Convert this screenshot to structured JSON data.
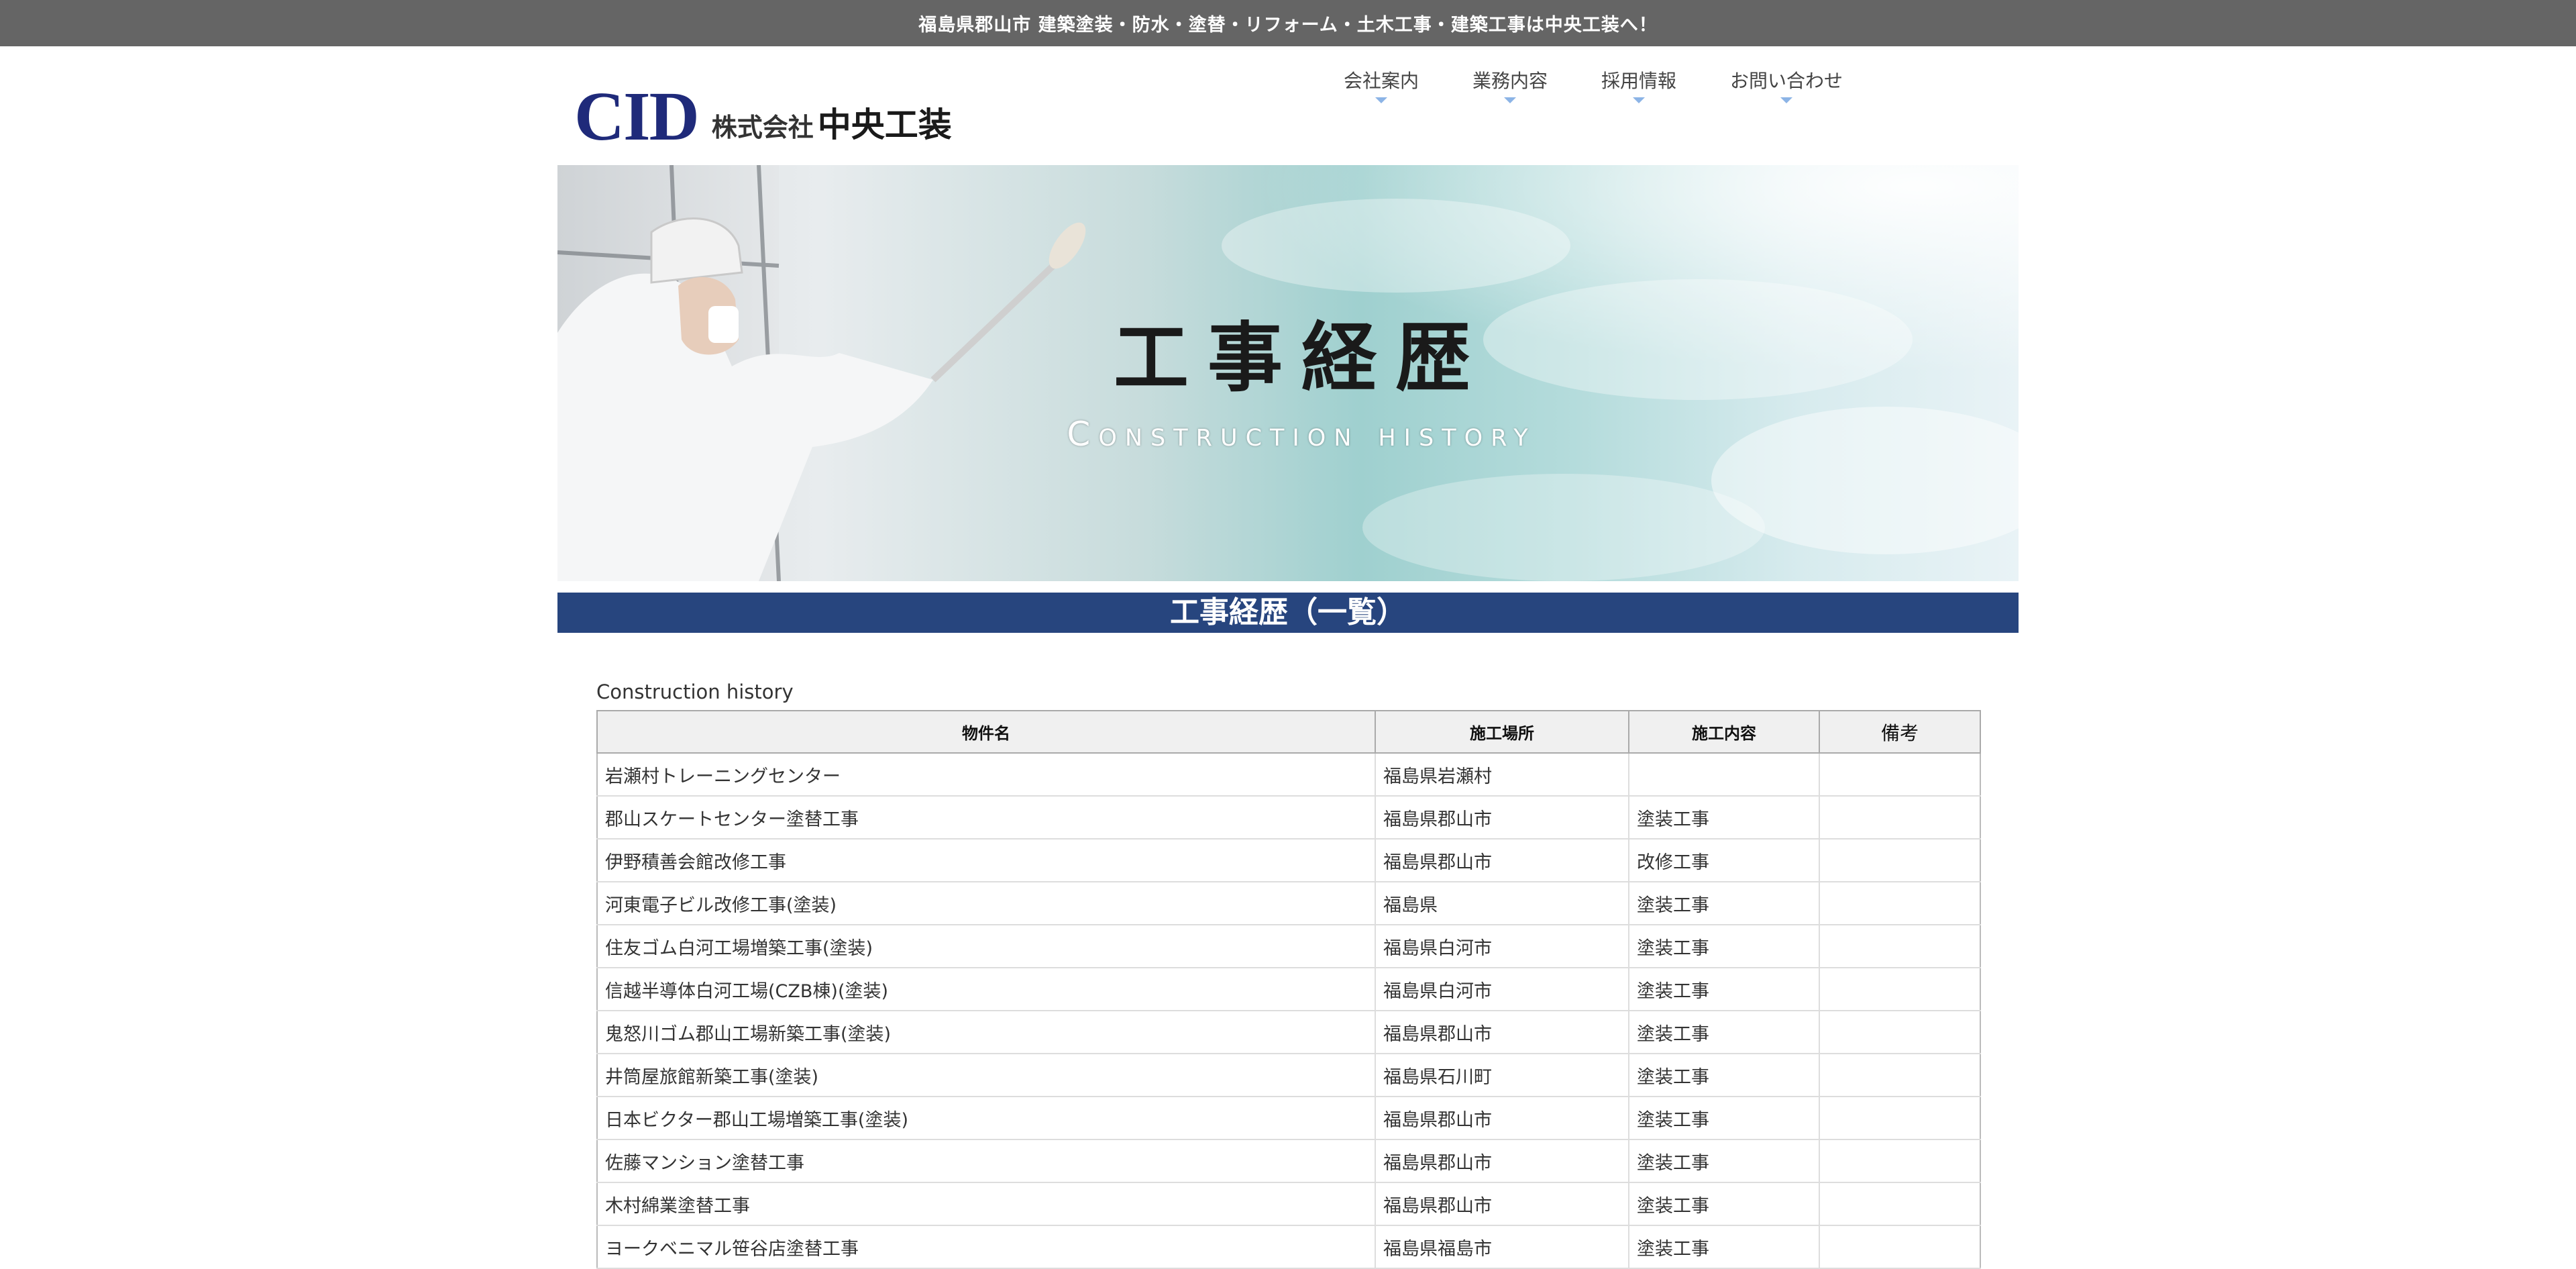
{
  "topbar": {
    "text": "福島県郡山市 建築塗装・防水・塗替・リフォーム・土木工事・建築工事は中央工装へ！"
  },
  "logo": {
    "mark": "CID",
    "kabu": "株式会社",
    "name": "中央工装"
  },
  "nav": {
    "items": [
      {
        "label": "会社案内"
      },
      {
        "label": "業務内容"
      },
      {
        "label": "採用情報"
      },
      {
        "label": "お問い合わせ"
      }
    ]
  },
  "hero": {
    "title_jp": "工事経歴",
    "title_en": "Construction history"
  },
  "banner": {
    "title": "工事経歴（一覧）"
  },
  "table": {
    "caption": "Construction history",
    "headers": [
      "物件名",
      "施工場所",
      "施工内容",
      "備考"
    ],
    "rows": [
      [
        "岩瀬村トレーニングセンター",
        "福島県岩瀬村",
        "",
        ""
      ],
      [
        "郡山スケートセンター塗替工事",
        "福島県郡山市",
        "塗装工事",
        ""
      ],
      [
        "伊野積善会館改修工事",
        "福島県郡山市",
        "改修工事",
        ""
      ],
      [
        "河東電子ビル改修工事(塗装)",
        "福島県",
        "塗装工事",
        ""
      ],
      [
        "住友ゴム白河工場増築工事(塗装)",
        "福島県白河市",
        "塗装工事",
        ""
      ],
      [
        "信越半導体白河工場(CZB棟)(塗装)",
        "福島県白河市",
        "塗装工事",
        ""
      ],
      [
        "鬼怒川ゴム郡山工場新築工事(塗装)",
        "福島県郡山市",
        "塗装工事",
        ""
      ],
      [
        "井筒屋旅館新築工事(塗装)",
        "福島県石川町",
        "塗装工事",
        ""
      ],
      [
        "日本ビクター郡山工場増築工事(塗装)",
        "福島県郡山市",
        "塗装工事",
        ""
      ],
      [
        "佐藤マンション塗替工事",
        "福島県郡山市",
        "塗装工事",
        ""
      ],
      [
        "木村綿業塗替工事",
        "福島県郡山市",
        "塗装工事",
        ""
      ],
      [
        "ヨークベニマル笹谷店塗替工事",
        "福島県福島市",
        "塗装工事",
        ""
      ]
    ]
  },
  "colors": {
    "topbar": "#656565",
    "banner": "#27457e",
    "logo": "#1f2a7a",
    "nav_caret": "#8cb4e6"
  }
}
